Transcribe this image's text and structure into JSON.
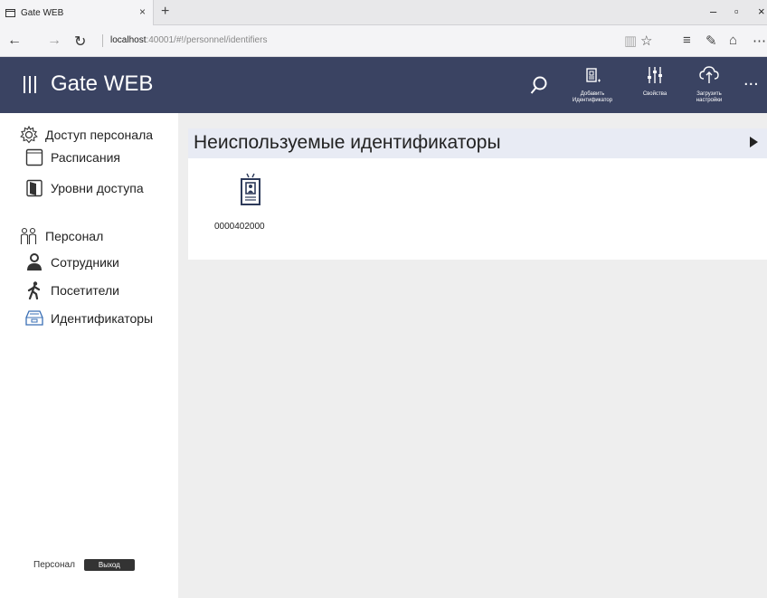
{
  "browser": {
    "tab_title": "Gate WEB",
    "tab_close": "×",
    "new_tab": "+",
    "url_host": "localhost",
    "url_rest": ":40001/#!/personnel/identifiers",
    "icons": [
      "back-arrow-icon",
      "forward-arrow-icon",
      "refresh-icon",
      "reading-view-icon",
      "favorite-star-icon",
      "hub-icon",
      "web-note-icon",
      "share-icon",
      "more-icon"
    ]
  },
  "header": {
    "title": "Gate WEB",
    "tools": [
      {
        "line1": "Добавить",
        "line2": "Идентификатор",
        "icon": "add-identifier-icon"
      },
      {
        "line1": "Свойства",
        "line2": "",
        "icon": "properties-sliders-icon"
      },
      {
        "line1": "Загрузить",
        "line2": "настройки",
        "icon": "cloud-upload-icon"
      }
    ],
    "more": "..."
  },
  "sidebar": {
    "sections": [
      {
        "label": "Доступ персонала",
        "icon": "gear-icon"
      },
      {
        "label": "Расписания",
        "icon": "calendar-icon"
      },
      {
        "label": "Уровни доступа",
        "icon": "door-icon"
      },
      {
        "label": "Персонал",
        "icon": "people-icon"
      },
      {
        "label": "Сотрудники",
        "icon": "employee-icon"
      },
      {
        "label": "Посетители",
        "icon": "walking-person-icon"
      },
      {
        "label": "Идентификаторы",
        "icon": "id-tray-icon"
      }
    ],
    "footer_user": "Персонал",
    "logout_label": "Выход"
  },
  "main": {
    "panel_title": "Неиспользуемые идентификаторы",
    "identifiers": [
      {
        "code": "0000402000",
        "icon": "id-badge-icon"
      }
    ]
  },
  "colors": {
    "header_bg": "#3a4362",
    "accent_blue": "#3a6fb5",
    "content_bg": "#eeeeee"
  }
}
